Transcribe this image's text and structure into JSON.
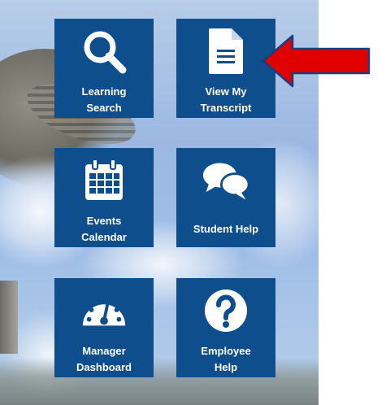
{
  "tiles": [
    {
      "label": "Learning\nSearch",
      "icon": "search-icon"
    },
    {
      "label": "View My\nTranscript",
      "icon": "document-icon"
    },
    {
      "label": "Events\nCalendar",
      "icon": "calendar-icon"
    },
    {
      "label": "Student Help",
      "icon": "chat-bubbles-icon"
    },
    {
      "label": "Manager\nDashboard",
      "icon": "dashboard-gauge-icon"
    },
    {
      "label": "Employee\nHelp",
      "icon": "question-circle-icon"
    }
  ],
  "colors": {
    "tile": "#0f4e8d",
    "arrow": "#e00000",
    "arrow_outline": "#1a3f7a"
  }
}
